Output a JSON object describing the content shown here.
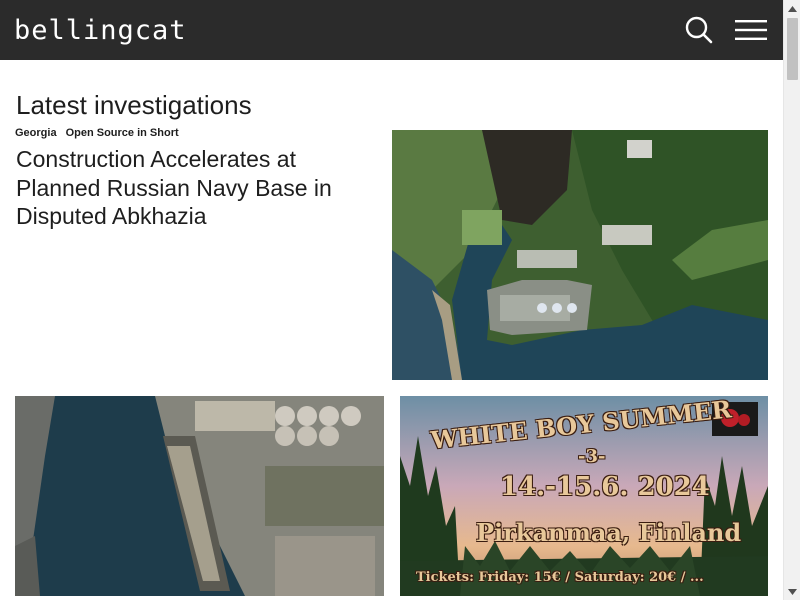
{
  "header": {
    "logo_text": "bellingcat",
    "search_icon": "search-icon",
    "menu_icon": "hamburger-menu-icon",
    "background_color": "#2b2b2b"
  },
  "main": {
    "section_title": "Latest investigations",
    "featured": {
      "tags": [
        "Georgia",
        "Open Source in Short"
      ],
      "headline": "Construction Accelerates at Planned Russian Navy Base in Disputed Abkhazia"
    },
    "poster": {
      "line1": "WHITE BOY SUMMER",
      "line2": "-3-",
      "line3": "14.-15.6. 2024",
      "line4": "Pirkanmaa, Finland",
      "line5": "Tickets: Friday: 15€ / Saturday: 20€ / ..."
    }
  }
}
